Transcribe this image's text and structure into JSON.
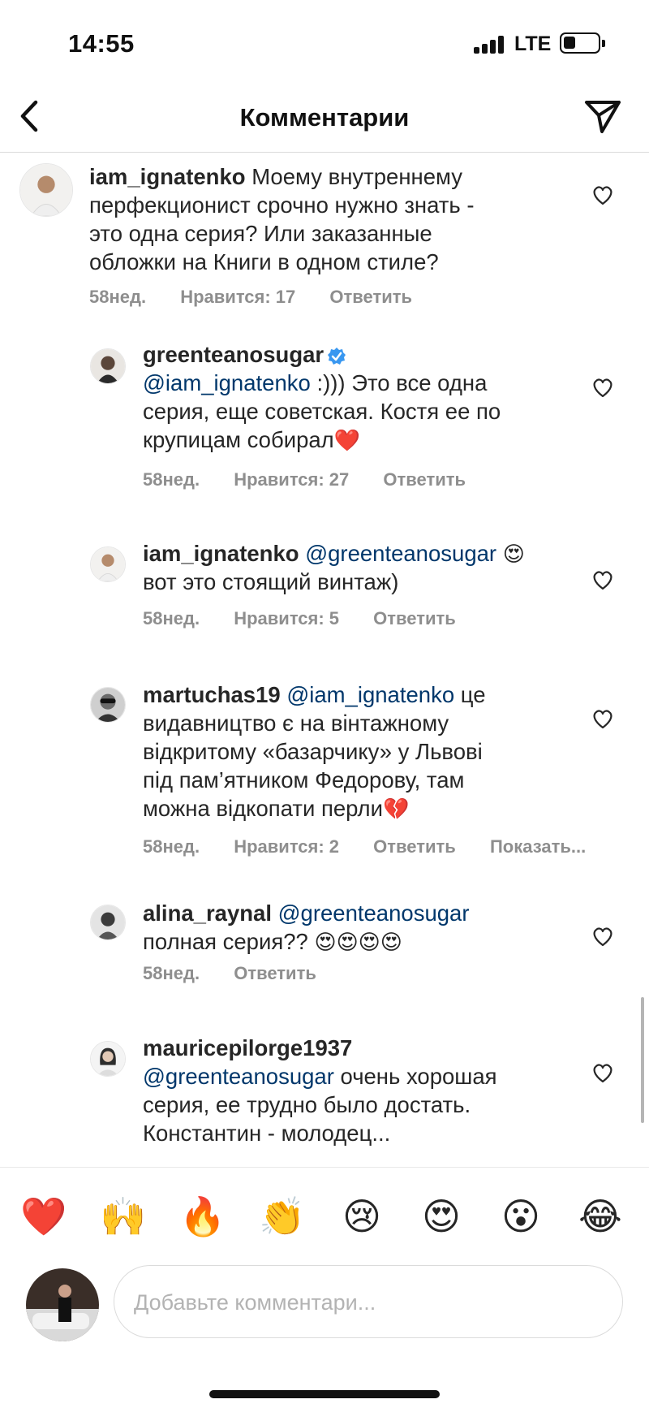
{
  "status_bar": {
    "time": "14:55",
    "network": "LTE",
    "icons": [
      "signal-icon",
      "battery-icon"
    ]
  },
  "header": {
    "title": "Комментарии",
    "back_icon": "chevron-left-icon",
    "send_icon": "paper-plane-icon"
  },
  "comments": [
    {
      "username": "iam_ignatenko",
      "verified": false,
      "mention": "",
      "text_lines": [
        "Моему внутреннему",
        "перфекционист срочно нужно знать -",
        "это одна серия? Или заказанные",
        "обложки на Книги в одном стиле?"
      ],
      "age": "58нед.",
      "likes": "Нравится: 17",
      "reply": "Ответить",
      "extra": ""
    },
    {
      "username": "greenteanosugar",
      "verified": true,
      "mention": "@iam_ignatenko",
      "text_lines": [
        ":))) Это все одна",
        "серия, еще советская. Костя ее по",
        "крупицам собирал"
      ],
      "trailing_emoji": "❤️",
      "age": "58нед.",
      "likes": "Нравится: 27",
      "reply": "Ответить",
      "extra": ""
    },
    {
      "username": "iam_ignatenko",
      "verified": false,
      "mention": "@greenteanosugar",
      "inline_emoji": "😍",
      "text_lines": [
        "вот это стоящий винтаж)"
      ],
      "age": "58нед.",
      "likes": "Нравится: 5",
      "reply": "Ответить",
      "extra": ""
    },
    {
      "username": "martuchas19",
      "verified": false,
      "mention": "@iam_ignatenko",
      "text_lines": [
        "це",
        "видавництво є на вінтажному",
        "відкритому «базарчику» у Львові",
        "під пам’ятником Федорову, там",
        "можна відкопати перли"
      ],
      "trailing_emoji": "💔",
      "age": "58нед.",
      "likes": "Нравится: 2",
      "reply": "Ответить",
      "extra": "Показать..."
    },
    {
      "username": "alina_raynal",
      "verified": false,
      "mention": "@greenteanosugar",
      "text_lines": [
        "полная серия??"
      ],
      "trailing_emoji": "😍😍😍😍",
      "age": "58нед.",
      "likes": "",
      "reply": "Ответить",
      "extra": ""
    },
    {
      "username": "mauricepilorge1937",
      "verified": false,
      "mention": "@greenteanosugar",
      "text_lines": [
        "очень хорошая",
        "серия, ее трудно было достать.",
        "Константин - молодец..."
      ],
      "age": "",
      "likes": "",
      "reply": "",
      "extra": ""
    }
  ],
  "reactions": [
    "❤️",
    "🙌",
    "🔥",
    "👏",
    "😢",
    "😍",
    "😮",
    "😂"
  ],
  "composer": {
    "placeholder": "Добавьте комментари...",
    "value": ""
  },
  "colors": {
    "text": "#262626",
    "meta": "#8e8e8e",
    "mention": "#00376b",
    "verified": "#3897f0",
    "border": "#dbdbdb"
  }
}
